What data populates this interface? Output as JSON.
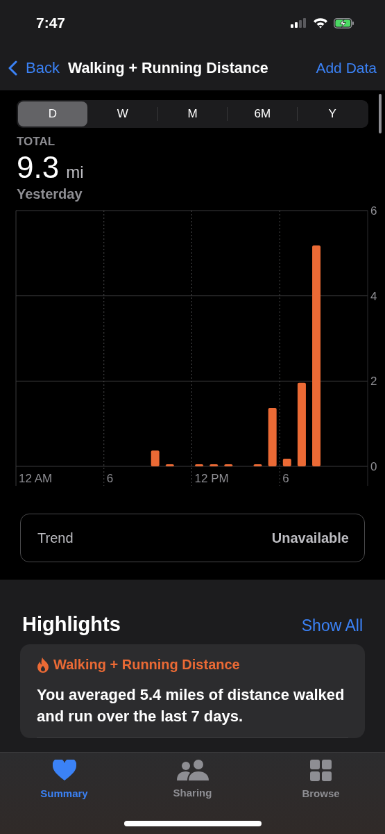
{
  "status_bar": {
    "time": "7:47"
  },
  "nav": {
    "back": "Back",
    "title": "Walking + Running Distance",
    "action": "Add Data"
  },
  "segments": [
    {
      "label": "D",
      "selected": true
    },
    {
      "label": "W",
      "selected": false
    },
    {
      "label": "M",
      "selected": false
    },
    {
      "label": "6M",
      "selected": false
    },
    {
      "label": "Y",
      "selected": false
    }
  ],
  "summary": {
    "label": "TOTAL",
    "value": "9.3",
    "unit": "mi",
    "period": "Yesterday"
  },
  "chart": {
    "axis_labels": [
      "12 AM",
      "6",
      "12 PM",
      "6"
    ],
    "chart_data": {
      "type": "bar",
      "series": [
        {
          "color": "#eb6a35",
          "values": [
            null,
            null,
            null,
            null,
            null,
            null,
            null,
            null,
            null,
            0.37,
            0.05,
            null,
            0.05,
            0.05,
            0.05,
            null,
            0.05,
            1.37,
            0.18,
            1.96,
            5.18,
            null,
            null,
            null
          ]
        }
      ],
      "ylim": [
        0,
        6
      ],
      "yticks": [
        0,
        2,
        4,
        6
      ]
    }
  },
  "trend": {
    "label": "Trend",
    "value": "Unavailable"
  },
  "highlights": {
    "title": "Highlights",
    "action": "Show All",
    "card": {
      "title": "Walking + Running Distance",
      "text": "You averaged 5.4 miles of distance walked and run over the last 7 days."
    }
  },
  "tab_bar": [
    {
      "label": "Summary",
      "kind": "heart",
      "selected": true
    },
    {
      "label": "Sharing",
      "kind": "people",
      "selected": false
    },
    {
      "label": "Browse",
      "kind": "grid",
      "selected": false
    }
  ]
}
